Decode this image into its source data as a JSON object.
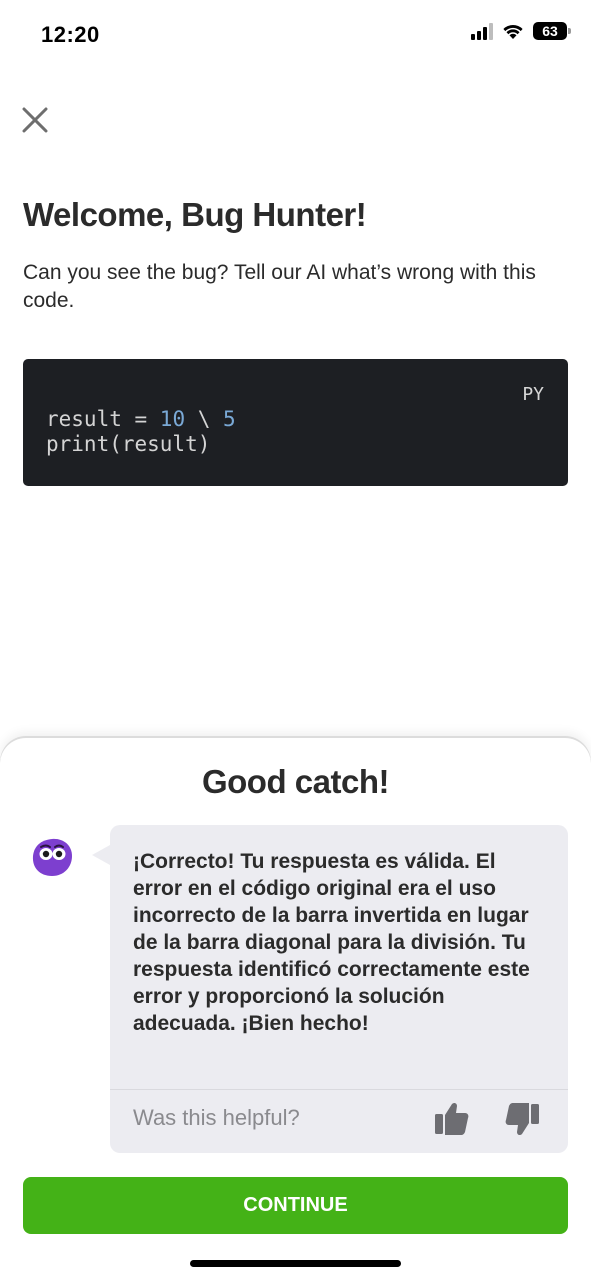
{
  "status_bar": {
    "time": "12:20",
    "battery": "63"
  },
  "page": {
    "title": "Welcome, Bug Hunter!",
    "subtitle": "Can you see the bug? Tell our AI what’s wrong with this code."
  },
  "code": {
    "language": "PY",
    "line1": {
      "prefix": "result = ",
      "num1": "10",
      "op": " \\ ",
      "num2": "5"
    },
    "line2": "print(result)"
  },
  "feedback": {
    "title": "Good catch!",
    "message": "¡Correcto! Tu respuesta es válida. El error en el código original era el uso incorrecto de la barra invertida en lugar de la barra diagonal para la división. Tu respuesta identificó correctamente este error y proporcionó la solución adecuada. ¡Bien hecho!",
    "helpful_prompt": "Was this helpful?",
    "continue_label": "CONTINUE"
  },
  "colors": {
    "accent": "#44b217",
    "avatar": "#7d3fcf",
    "code_bg": "#1d1f23",
    "number": "#7aa9d6"
  },
  "icons": [
    "close-icon",
    "signal-icon",
    "wifi-icon",
    "battery-icon",
    "mascot-avatar",
    "thumbs-up-icon",
    "thumbs-down-icon"
  ]
}
